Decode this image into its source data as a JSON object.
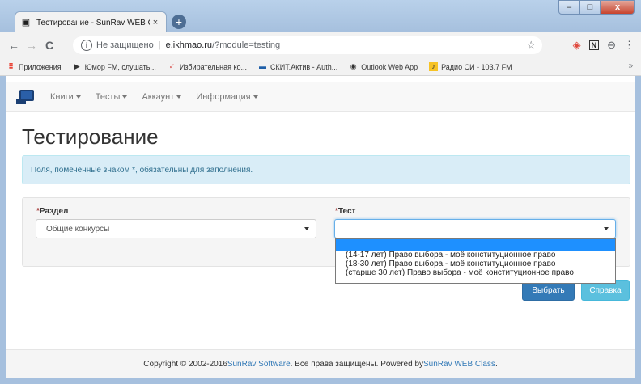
{
  "browser": {
    "tab_title": "Тестирование - SunRav WEB Cla",
    "tab_close": "×",
    "new_tab": "+",
    "window": {
      "minimize": "–",
      "maximize": "□",
      "close": "x"
    },
    "nav": {
      "back": "←",
      "forward": "→",
      "reload": "C"
    },
    "address": {
      "security_text": "Не защищено",
      "separator": "|",
      "host": "e.ikhmao.ru",
      "path": "/?module=testing",
      "star": "☆"
    },
    "profile_icon": "⊖",
    "menu_icon": "⋮",
    "bookmarks": [
      {
        "icon": "apps-grid-icon",
        "glyph": "⠿",
        "label": "Приложения"
      },
      {
        "icon": "play-icon",
        "glyph": "▶",
        "label": "Юмор FM, слушать..."
      },
      {
        "icon": "check-icon",
        "glyph": "✓",
        "label": "Избирательная ко..."
      },
      {
        "icon": "card-icon",
        "glyph": "▬",
        "label": "СКИТ.Актив - Auth..."
      },
      {
        "icon": "globe-icon",
        "glyph": "◉",
        "label": "Outlook Web App"
      },
      {
        "icon": "radio-icon",
        "glyph": "♪",
        "label": "Радио СИ - 103.7 FM"
      }
    ],
    "bookmarks_more": "»"
  },
  "navbar": {
    "menus": [
      "Книги",
      "Тесты",
      "Аккаунт",
      "Информация"
    ]
  },
  "page": {
    "title": "Тестирование",
    "alert": "Поля, помеченные знаком *, обязательны для заполнения.",
    "section_label": "Раздел",
    "section_value": "Общие конкурсы",
    "test_label": "Тест",
    "test_value": "",
    "required_mark": "*",
    "test_options": [
      "",
      "(14-17 лет) Право выбора - моё конституционное право",
      "(18-30 лет) Право выбора - моё конституционное право",
      "(старше 30 лет) Право выбора - моё конституционное право"
    ],
    "buttons": {
      "select": "Выбрать",
      "help": "Справка"
    }
  },
  "footer": {
    "copyright": "Copyright © 2002-2016 ",
    "company": "SunRav Software",
    "rights": ". Все права защищены. Powered by ",
    "product": "SunRav WEB Class",
    "end": "."
  },
  "colors": {
    "primary": "#337ab7",
    "info": "#5bc0de",
    "alert_bg": "#d9edf7",
    "highlight": "#1e90ff"
  }
}
